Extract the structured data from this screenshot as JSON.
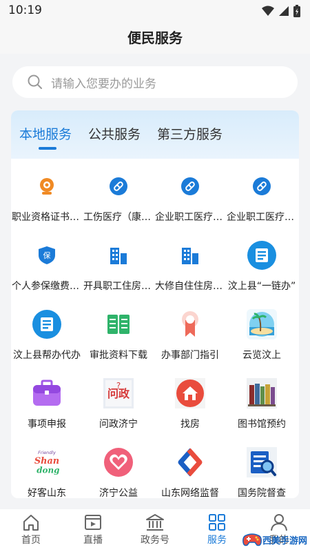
{
  "status_bar": {
    "time": "10:19"
  },
  "header": {
    "title": "便民服务"
  },
  "search": {
    "placeholder": "请输入您要办的业务"
  },
  "tabs": [
    {
      "label": "本地服务",
      "active": true
    },
    {
      "label": "公共服务",
      "active": false
    },
    {
      "label": "第三方服务",
      "active": false
    }
  ],
  "services": [
    {
      "label": "职业资格证书查询",
      "icon": "webcam-icon"
    },
    {
      "label": "工伤医疗（康复）",
      "icon": "medicine-icon"
    },
    {
      "label": "企业职工医疗保险",
      "icon": "medicine-icon"
    },
    {
      "label": "企业职工医疗保险",
      "icon": "medicine-icon"
    },
    {
      "label": "个人参保缴费证明",
      "icon": "insurance-shield-icon"
    },
    {
      "label": "开具职工住房证明",
      "icon": "building-icon"
    },
    {
      "label": "大修自住住房证明",
      "icon": "building-icon"
    },
    {
      "label": "汶上县“一链办”",
      "icon": "document-circle-icon"
    },
    {
      "label": "汶上县帮办代办",
      "icon": "document-circle-icon"
    },
    {
      "label": "审批资料下载",
      "icon": "open-book-icon"
    },
    {
      "label": "办事部门指引",
      "icon": "ribbon-icon"
    },
    {
      "label": "云览汶上",
      "icon": "beach-icon"
    },
    {
      "label": "事项申报",
      "icon": "briefcase-icon"
    },
    {
      "label": "问政济宁",
      "icon": "inquiry-icon"
    },
    {
      "label": "找房",
      "icon": "house-icon"
    },
    {
      "label": "图书馆预约",
      "icon": "books-icon"
    },
    {
      "label": "好客山东",
      "icon": "shandong-logo-icon",
      "logo_text": "Shan dong",
      "logo_small": "Friendly"
    },
    {
      "label": "济宁公益",
      "icon": "heart-icon"
    },
    {
      "label": "山东网络监督",
      "icon": "network-supervision-icon"
    },
    {
      "label": "国务院督查",
      "icon": "state-council-inspection-icon"
    }
  ],
  "bottom_nav": [
    {
      "label": "首页",
      "icon": "home-icon"
    },
    {
      "label": "直播",
      "icon": "video-icon"
    },
    {
      "label": "政务号",
      "icon": "government-icon"
    },
    {
      "label": "服务",
      "icon": "grid-icon",
      "active": true
    },
    {
      "label": "我的",
      "icon": "user-icon"
    }
  ],
  "watermark": {
    "text": "西美手游网",
    "url": "www.hanxm.com"
  },
  "colors": {
    "accent": "#1b7bd8",
    "orange": "#f08a24",
    "green": "#2fb36a",
    "red": "#e94c3d",
    "purple": "#a35ae8"
  }
}
